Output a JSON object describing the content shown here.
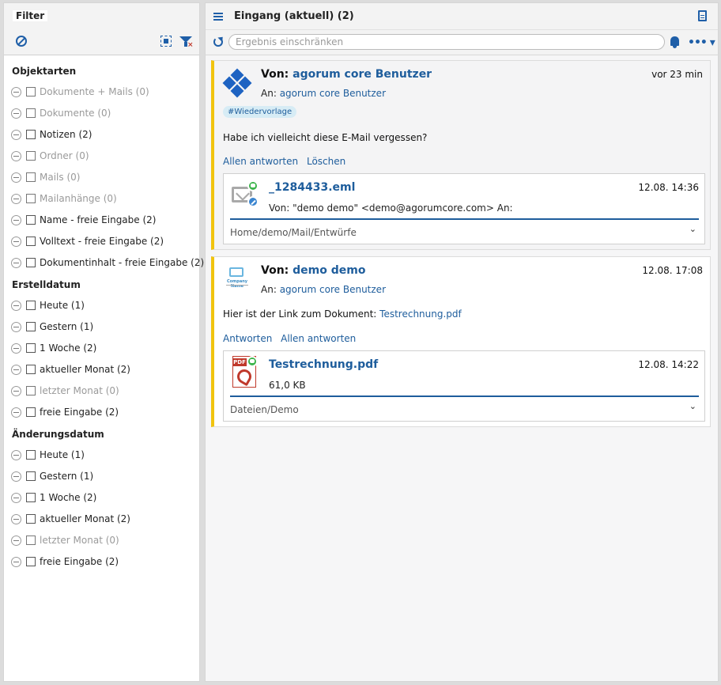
{
  "filter": {
    "title": "Filter",
    "sections": [
      {
        "title": "Objektarten",
        "items": [
          {
            "label": "Dokumente + Mails (0)",
            "disabled": true
          },
          {
            "label": "Dokumente (0)",
            "disabled": true
          },
          {
            "label": "Notizen (2)",
            "disabled": false
          },
          {
            "label": "Ordner (0)",
            "disabled": true
          },
          {
            "label": "Mails (0)",
            "disabled": true
          },
          {
            "label": "Mailanhänge (0)",
            "disabled": true
          },
          {
            "label": "Name - freie Eingabe (2)",
            "disabled": false
          },
          {
            "label": "Volltext - freie Eingabe (2)",
            "disabled": false
          },
          {
            "label": "Dokumentinhalt - freie Eingabe (2)",
            "disabled": false
          }
        ]
      },
      {
        "title": "Erstelldatum",
        "items": [
          {
            "label": "Heute (1)",
            "disabled": false
          },
          {
            "label": "Gestern (1)",
            "disabled": false
          },
          {
            "label": "1 Woche (2)",
            "disabled": false
          },
          {
            "label": "aktueller Monat (2)",
            "disabled": false
          },
          {
            "label": "letzter Monat (0)",
            "disabled": true
          },
          {
            "label": "freie Eingabe (2)",
            "disabled": false
          }
        ]
      },
      {
        "title": "Änderungsdatum",
        "items": [
          {
            "label": "Heute (1)",
            "disabled": false
          },
          {
            "label": "Gestern (1)",
            "disabled": false
          },
          {
            "label": "1 Woche (2)",
            "disabled": false
          },
          {
            "label": "aktueller Monat (2)",
            "disabled": false
          },
          {
            "label": "letzter Monat (0)",
            "disabled": true
          },
          {
            "label": "freie Eingabe (2)",
            "disabled": false
          }
        ]
      }
    ]
  },
  "inbox": {
    "title": "Eingang (aktuell) (2)",
    "search_placeholder": "Ergebnis einschränken",
    "more_label": "•••"
  },
  "messages": [
    {
      "von_label": "Von:",
      "from": "agorum core Benutzer",
      "an_label": "An:",
      "to": "agorum core Benutzer",
      "time": "vor 23 min",
      "tag": "#Wiedervorlage",
      "body": "Habe ich vielleicht diese E-Mail vergessen?",
      "actions": [
        "Allen antworten",
        "Löschen"
      ],
      "attachment": {
        "name": "_1284433.eml",
        "date": "12.08. 14:36",
        "info": "Von: \"demo demo\" <demo@agorumcore.com>  An:",
        "path": "Home/demo/Mail/Entwürfe"
      }
    },
    {
      "von_label": "Von:",
      "from": "demo demo",
      "an_label": "An:",
      "to": "agorum core Benutzer",
      "time": "12.08. 17:08",
      "body_prefix": "Hier ist der Link zum Dokument:",
      "body_link": "Testrechnung.pdf",
      "actions": [
        "Antworten",
        "Allen antworten"
      ],
      "logo_text": "Company Name",
      "attachment": {
        "name": "Testrechnung.pdf",
        "date": "12.08. 14:22",
        "info": "61,0 KB",
        "path": "Dateien/Demo",
        "pdf_label": "PDF"
      }
    }
  ],
  "colors": {
    "accent": "#1f5fa8",
    "link": "#1e5d9c",
    "card_border_left": "#f1c40f",
    "disabled_text": "#9a9a9a"
  }
}
